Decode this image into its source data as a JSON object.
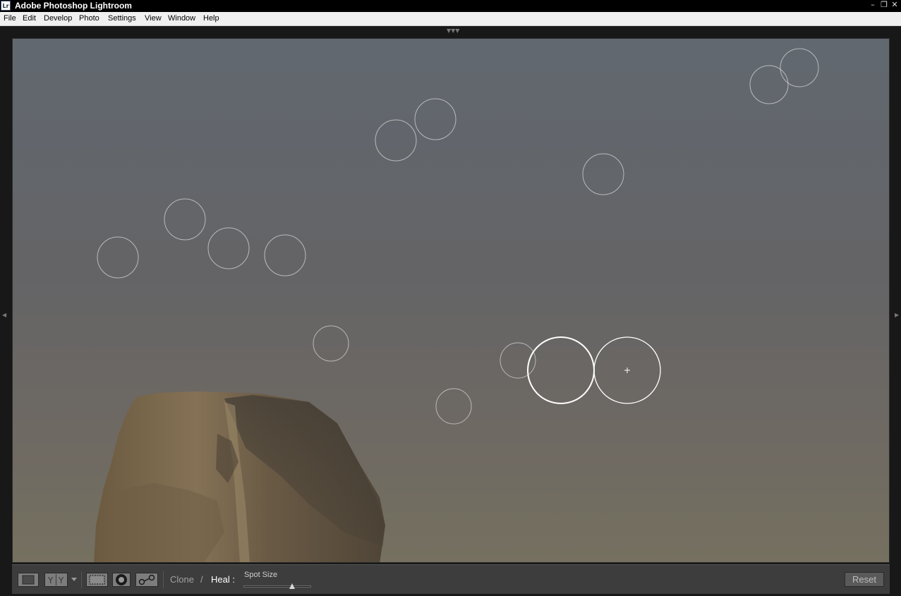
{
  "window": {
    "logo": "Lr",
    "title": "Adobe Photoshop Lightroom",
    "controls": {
      "minimize": "–",
      "restore": "❐",
      "close": "✕"
    }
  },
  "menu": [
    "File",
    "Edit",
    "Develop",
    "Photo",
    "Settings",
    "View",
    "Window",
    "Help"
  ],
  "canvas": {
    "icons": {
      "top": "panel-toggle-top-icon",
      "left": "panel-toggle-left-icon",
      "right": "panel-toggle-right-icon"
    }
  },
  "toolbar": {
    "view_mode_icons": [
      "loupe-view-icon",
      "before-after-view-icon"
    ],
    "tool_icons": [
      "crop-overlay-icon",
      "spot-removal-icon",
      "red-eye-icon"
    ],
    "mode_clone": "Clone",
    "mode_separator": "/",
    "mode_heal": "Heal :",
    "active_mode": "Heal",
    "spot_size_label": "Spot Size",
    "spot_size_value": 0.72,
    "reset_label": "Reset"
  },
  "colors": {
    "titlebar": "#000000",
    "menubar": "#f0f0f0",
    "toolbar": "#3d3d3d",
    "active_mode_text": "#ffffff",
    "inactive_mode_text": "#a0a0a0"
  }
}
